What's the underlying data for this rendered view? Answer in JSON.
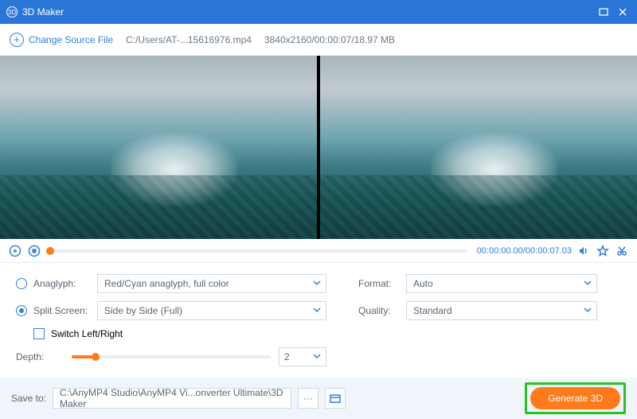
{
  "titlebar": {
    "title": "3D Maker"
  },
  "toolbar": {
    "change_source_label": "Change Source File",
    "file_path": "C:/Users/AT-...15616976.mp4",
    "file_info": "3840x2160/00:00:07/18.97 MB"
  },
  "playbar": {
    "current": "00:00:00.00",
    "separator": "/",
    "duration": "00:00:07.03"
  },
  "settings": {
    "anaglyph_label": "Anaglyph:",
    "anaglyph_value": "Red/Cyan anaglyph, full color",
    "splitscreen_label": "Split Screen:",
    "splitscreen_value": "Side by Side (Full)",
    "switch_label": "Switch Left/Right",
    "depth_label": "Depth:",
    "depth_value": "2",
    "format_label": "Format:",
    "format_value": "Auto",
    "quality_label": "Quality:",
    "quality_value": "Standard"
  },
  "footer": {
    "save_label": "Save to:",
    "save_path": "C:\\AnyMP4 Studio\\AnyMP4 Vi...onverter Ultimate\\3D Maker",
    "browse": "···",
    "generate_label": "Generate 3D"
  }
}
